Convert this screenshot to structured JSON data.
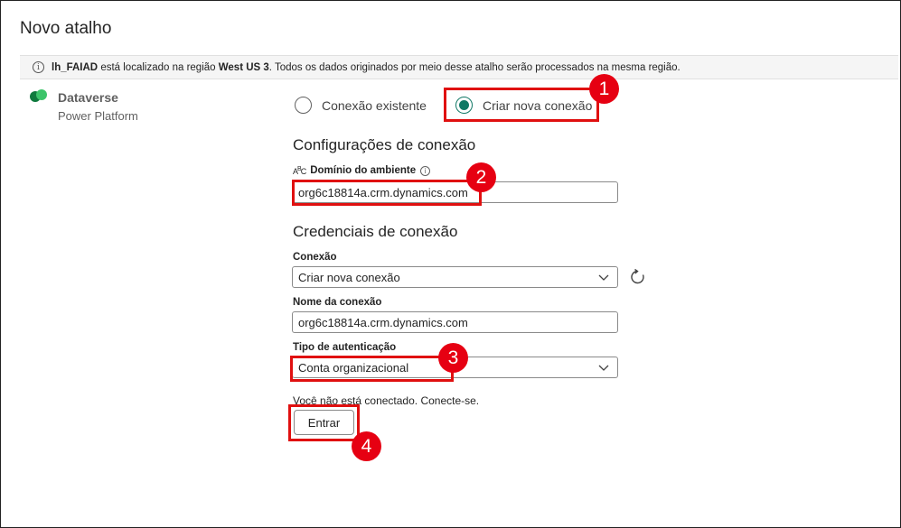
{
  "dialog": {
    "title": "Novo atalho"
  },
  "info_bar": {
    "lakehouse": "lh_FAIAD",
    "text_1": " está localizado na região ",
    "region": "West US 3",
    "text_2": ". Todos os dados originados por meio desse atalho serão processados na mesma região."
  },
  "source": {
    "name": "Dataverse",
    "subtitle": "Power Platform"
  },
  "connection_mode": {
    "existing_label": "Conexão existente",
    "new_label": "Criar nova conexão",
    "selected": "new"
  },
  "connection_settings": {
    "heading": "Configurações de conexão",
    "environment_domain_label": "Domínio do ambiente",
    "environment_domain_value": "org6c18814a.crm.dynamics.com"
  },
  "credentials": {
    "heading": "Credenciais de conexão",
    "connection_label": "Conexão",
    "connection_value": "Criar nova conexão",
    "connection_name_label": "Nome da conexão",
    "connection_name_value": "org6c18814a.crm.dynamics.com",
    "auth_type_label": "Tipo de autenticação",
    "auth_type_value": "Conta organizacional"
  },
  "sign_in": {
    "status_text": "Você não está conectado. Conecte-se.",
    "button_label": "Entrar"
  },
  "callouts": [
    "1",
    "2",
    "3",
    "4"
  ],
  "colors": {
    "accent": "#117865",
    "callout": "#e60012",
    "highlight": "#e01010"
  }
}
